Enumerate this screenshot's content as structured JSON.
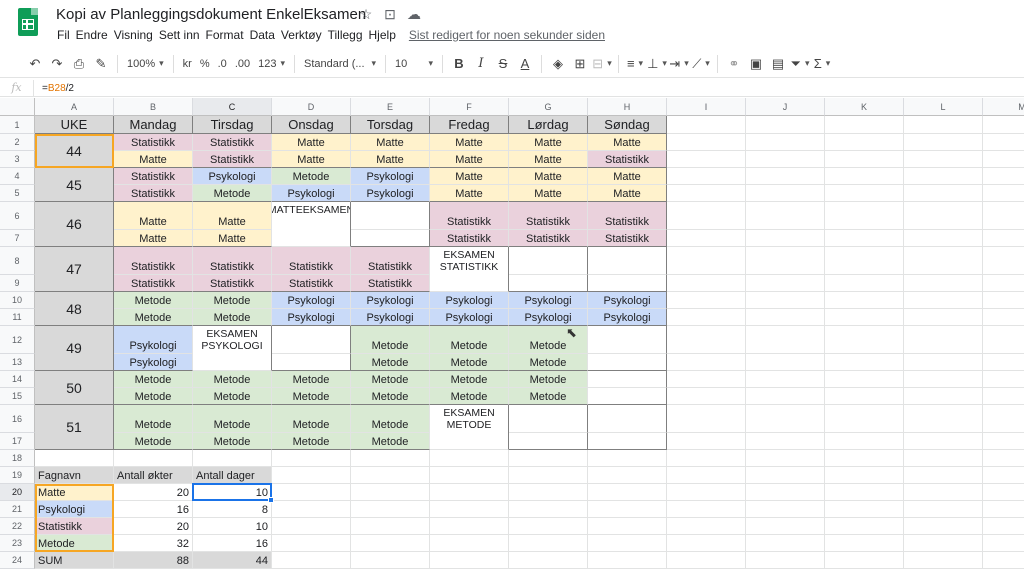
{
  "doc": {
    "title": "Kopi av Planleggingsdokument EnkelEksamen",
    "last_edit": "Sist redigert for noen sekunder siden"
  },
  "icons": {
    "star": "star-icon",
    "folder": "move-to-folder-icon",
    "cloud": "cloud-saved-icon",
    "logo": "sheets-logo-icon"
  },
  "menu": [
    "Fil",
    "Endre",
    "Visning",
    "Sett inn",
    "Format",
    "Data",
    "Verktøy",
    "Tillegg",
    "Hjelp"
  ],
  "toolbar": {
    "zoom": "100%",
    "currency": "kr",
    "percent": "%",
    "dec_less": ".0",
    "dec_more": ".00",
    "more_formats": "123",
    "font": "Standard (...",
    "font_size": "10"
  },
  "formula": {
    "prefix": "=",
    "ref": "B28",
    "suffix": "/2"
  },
  "columns": [
    "A",
    "B",
    "C",
    "D",
    "E",
    "F",
    "G",
    "H",
    "I",
    "J",
    "K",
    "L",
    "M"
  ],
  "rows": [
    "1",
    "2",
    "3",
    "4",
    "5",
    "6",
    "7",
    "8",
    "9",
    "10",
    "11",
    "12",
    "13",
    "14",
    "15",
    "16",
    "17",
    "18",
    "19",
    "20",
    "21",
    "22",
    "23",
    "24"
  ],
  "headers": [
    "UKE",
    "Mandag",
    "Tirsdag",
    "Onsdag",
    "Torsdag",
    "Fredag",
    "Lørdag",
    "Søndag"
  ],
  "weeks": [
    {
      "week": "44",
      "rows": [
        [
          [
            "Statistikk",
            "stat"
          ],
          [
            "Statistikk",
            "stat"
          ],
          [
            "Matte",
            "matte"
          ],
          [
            "Matte",
            "matte"
          ],
          [
            "Matte",
            "matte"
          ],
          [
            "Matte",
            "matte"
          ],
          [
            "Matte",
            "matte"
          ]
        ],
        [
          [
            "Matte",
            "matte"
          ],
          [
            "Statistikk",
            "stat"
          ],
          [
            "Matte",
            "matte"
          ],
          [
            "Matte",
            "matte"
          ],
          [
            "Matte",
            "matte"
          ],
          [
            "Matte",
            "matte"
          ],
          [
            "Statistikk",
            "stat"
          ]
        ]
      ]
    },
    {
      "week": "45",
      "rows": [
        [
          [
            "Statistikk",
            "stat"
          ],
          [
            "Psykologi",
            "psyk"
          ],
          [
            "Metode",
            "meto"
          ],
          [
            "Psykologi",
            "psyk"
          ],
          [
            "Matte",
            "matte"
          ],
          [
            "Matte",
            "matte"
          ],
          [
            "Matte",
            "matte"
          ]
        ],
        [
          [
            "Statistikk",
            "stat"
          ],
          [
            "Metode",
            "meto"
          ],
          [
            "Psykologi",
            "psyk"
          ],
          [
            "Psykologi",
            "psyk"
          ],
          [
            "Matte",
            "matte"
          ],
          [
            "Matte",
            "matte"
          ],
          [
            "Matte",
            "matte"
          ]
        ]
      ]
    },
    {
      "week": "46",
      "rows": [
        [
          [
            "Matte",
            "matte"
          ],
          [
            "Matte",
            "matte"
          ],
          [
            "MATTEEKSAMEN",
            "white"
          ],
          [
            "",
            "white"
          ],
          [
            "Statistikk",
            "stat"
          ],
          [
            "Statistikk",
            "stat"
          ],
          [
            "Statistikk",
            "stat"
          ]
        ],
        [
          [
            "Matte",
            "matte"
          ],
          [
            "Matte",
            "matte"
          ],
          [
            "",
            "white"
          ],
          [
            "",
            "white"
          ],
          [
            "Statistikk",
            "stat"
          ],
          [
            "Statistikk",
            "stat"
          ],
          [
            "Statistikk",
            "stat"
          ]
        ]
      ]
    },
    {
      "week": "47",
      "rows": [
        [
          [
            "Statistikk",
            "stat"
          ],
          [
            "Statistikk",
            "stat"
          ],
          [
            "Statistikk",
            "stat"
          ],
          [
            "Statistikk",
            "stat"
          ],
          [
            "EKSAMEN STATISTIKK",
            "white"
          ],
          [
            "",
            "white"
          ],
          [
            "",
            "white"
          ]
        ],
        [
          [
            "Statistikk",
            "stat"
          ],
          [
            "Statistikk",
            "stat"
          ],
          [
            "Statistikk",
            "stat"
          ],
          [
            "Statistikk",
            "stat"
          ],
          [
            "",
            "white"
          ],
          [
            "",
            "white"
          ],
          [
            "",
            "white"
          ]
        ]
      ]
    },
    {
      "week": "48",
      "rows": [
        [
          [
            "Metode",
            "meto"
          ],
          [
            "Metode",
            "meto"
          ],
          [
            "Psykologi",
            "psyk"
          ],
          [
            "Psykologi",
            "psyk"
          ],
          [
            "Psykologi",
            "psyk"
          ],
          [
            "Psykologi",
            "psyk"
          ],
          [
            "Psykologi",
            "psyk"
          ]
        ],
        [
          [
            "Metode",
            "meto"
          ],
          [
            "Metode",
            "meto"
          ],
          [
            "Psykologi",
            "psyk"
          ],
          [
            "Psykologi",
            "psyk"
          ],
          [
            "Psykologi",
            "psyk"
          ],
          [
            "Psykologi",
            "psyk"
          ],
          [
            "Psykologi",
            "psyk"
          ]
        ]
      ]
    },
    {
      "week": "49",
      "rows": [
        [
          [
            "Psykologi",
            "psyk"
          ],
          [
            "EKSAMEN PSYKOLOGI",
            "white"
          ],
          [
            "",
            "white"
          ],
          [
            "Metode",
            "meto"
          ],
          [
            "Metode",
            "meto"
          ],
          [
            "Metode",
            "meto"
          ],
          [
            "",
            "white"
          ]
        ],
        [
          [
            "Psykologi",
            "psyk"
          ],
          [
            "",
            "white"
          ],
          [
            "",
            "white"
          ],
          [
            "Metode",
            "meto"
          ],
          [
            "Metode",
            "meto"
          ],
          [
            "Metode",
            "meto"
          ],
          [
            "",
            "white"
          ]
        ]
      ]
    },
    {
      "week": "50",
      "rows": [
        [
          [
            "Metode",
            "meto"
          ],
          [
            "Metode",
            "meto"
          ],
          [
            "Metode",
            "meto"
          ],
          [
            "Metode",
            "meto"
          ],
          [
            "Metode",
            "meto"
          ],
          [
            "Metode",
            "meto"
          ],
          [
            "",
            "white"
          ]
        ],
        [
          [
            "Metode",
            "meto"
          ],
          [
            "Metode",
            "meto"
          ],
          [
            "Metode",
            "meto"
          ],
          [
            "Metode",
            "meto"
          ],
          [
            "Metode",
            "meto"
          ],
          [
            "Metode",
            "meto"
          ],
          [
            "",
            "white"
          ]
        ]
      ]
    },
    {
      "week": "51",
      "rows": [
        [
          [
            "Metode",
            "meto"
          ],
          [
            "Metode",
            "meto"
          ],
          [
            "Metode",
            "meto"
          ],
          [
            "Metode",
            "meto"
          ],
          [
            "EKSAMEN METODE",
            "white"
          ],
          [
            "",
            "white"
          ],
          [
            "",
            "white"
          ]
        ],
        [
          [
            "Metode",
            "meto"
          ],
          [
            "Metode",
            "meto"
          ],
          [
            "Metode",
            "meto"
          ],
          [
            "Metode",
            "meto"
          ],
          [
            "",
            "white"
          ],
          [
            "",
            "white"
          ],
          [
            "",
            "white"
          ]
        ]
      ]
    }
  ],
  "summary": {
    "headers": [
      "Fagnavn",
      "Antall økter",
      "Antall dager"
    ],
    "rows": [
      [
        "Matte",
        "20",
        "10",
        "matte"
      ],
      [
        "Psykologi",
        "16",
        "8",
        "psyk"
      ],
      [
        "Statistikk",
        "20",
        "10",
        "stat"
      ],
      [
        "Metode",
        "32",
        "16",
        "meto"
      ]
    ],
    "total": [
      "SUM",
      "88",
      "44"
    ]
  },
  "colors": {
    "matte": "#fff2cc",
    "stat": "#ead1dc",
    "psyk": "#c9daf8",
    "meto": "#d9ead3",
    "header": "#d9d9d9",
    "selection": "#1a73e8",
    "brand": "#0f9d58"
  }
}
